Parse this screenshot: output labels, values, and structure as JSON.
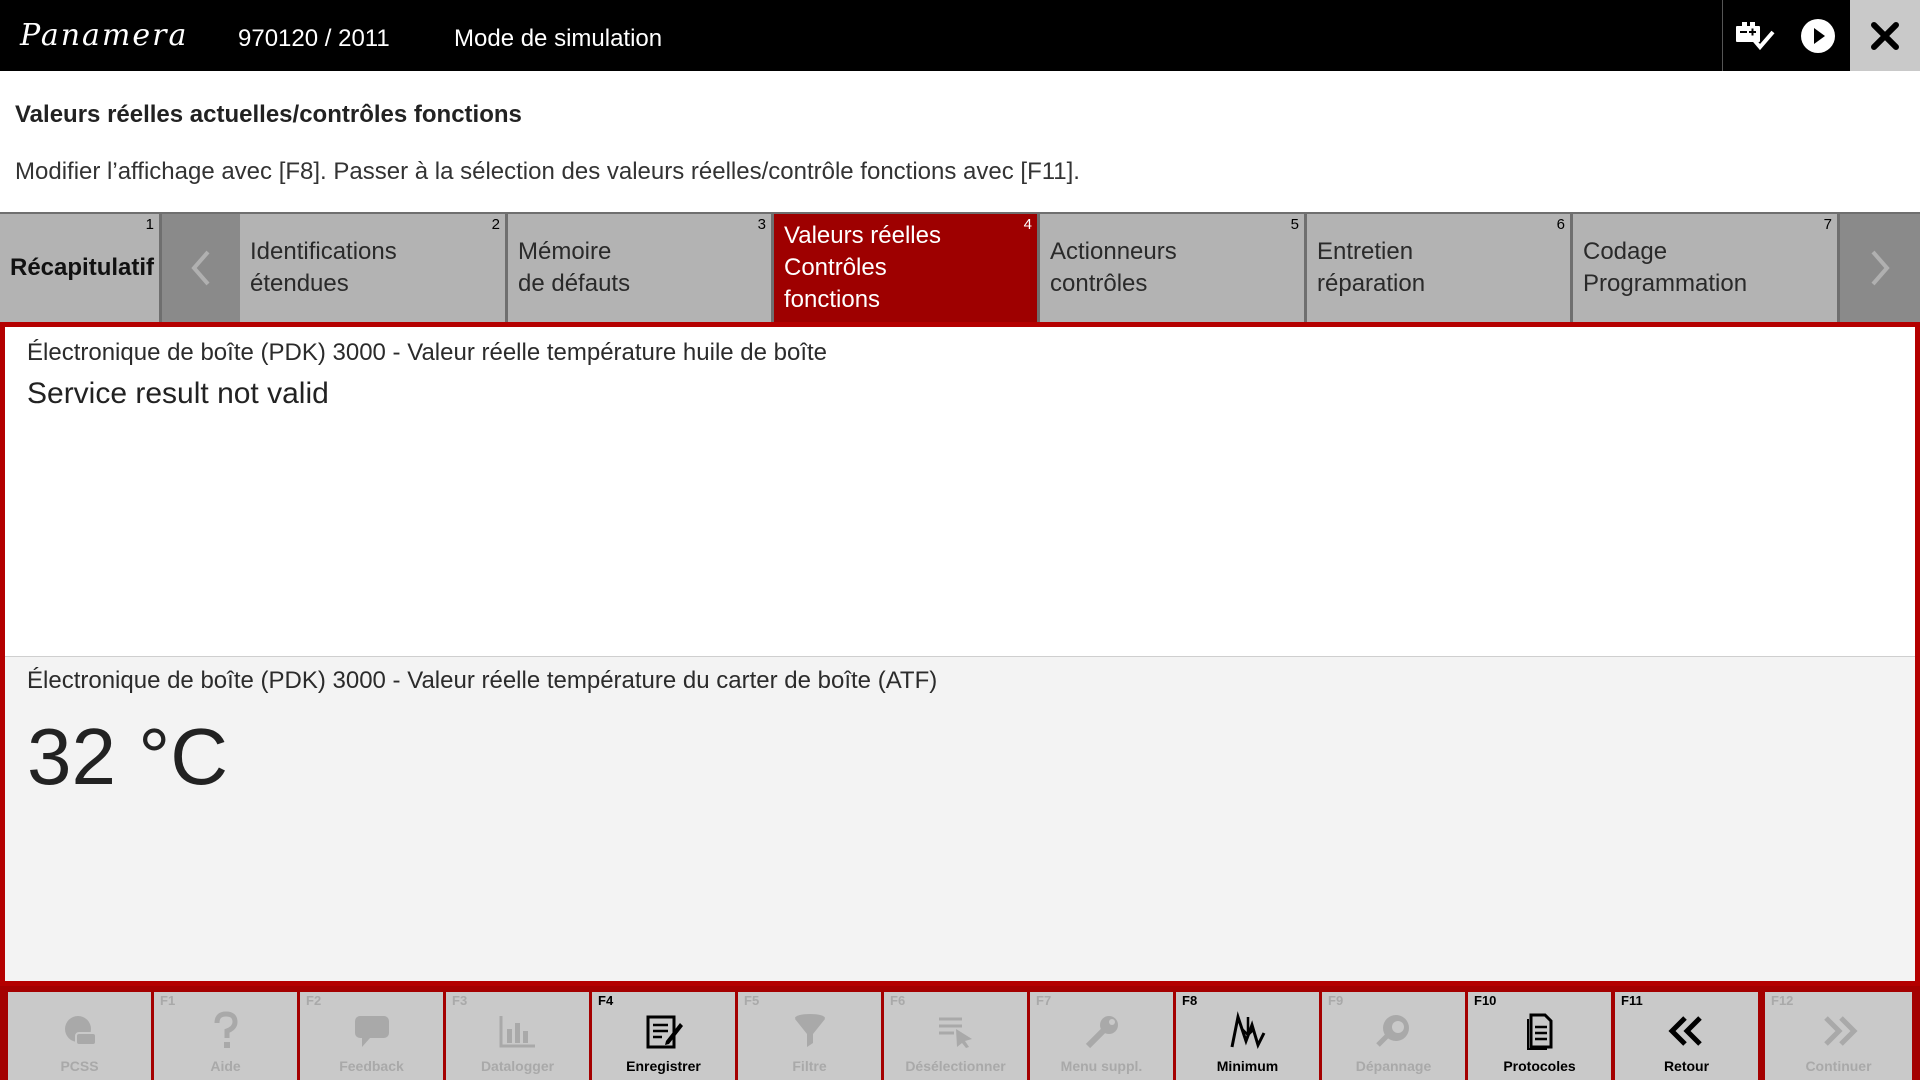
{
  "window": {
    "brand": "Panamera",
    "vehicle_id": "970120 / 2011",
    "mode": "Mode de simulation",
    "icons": [
      "vci-status-icon",
      "play-icon",
      "close-icon"
    ]
  },
  "header": {
    "title": "Valeurs réelles actuelles/contrôles fonctions",
    "hint": "Modifier l’affichage avec [F8]. Passer à la sélection des valeurs réelles/contrôle fonctions avec [F11]."
  },
  "tabs": [
    {
      "num": "1",
      "lines": [
        "Récapitulatif"
      ],
      "active": false
    },
    {
      "num": "2",
      "lines": [
        "Identifications",
        "étendues"
      ],
      "active": false
    },
    {
      "num": "3",
      "lines": [
        "Mémoire",
        "de défauts"
      ],
      "active": false
    },
    {
      "num": "4",
      "lines": [
        "Valeurs réelles",
        "Contrôles",
        "fonctions"
      ],
      "active": true
    },
    {
      "num": "5",
      "lines": [
        "Actionneurs",
        "contrôles"
      ],
      "active": false
    },
    {
      "num": "6",
      "lines": [
        "Entretien",
        "réparation"
      ],
      "active": false
    },
    {
      "num": "7",
      "lines": [
        "Codage",
        "Programmation"
      ],
      "active": false
    }
  ],
  "panels": [
    {
      "label": "Électronique de boîte (PDK) 3000 - Valeur réelle température huile de boîte",
      "value": "Service result not valid"
    },
    {
      "label": "Électronique de boîte (PDK) 3000 - Valeur réelle température du carter de boîte (ATF)",
      "value": "32 °C"
    }
  ],
  "fkeys": [
    {
      "key": "",
      "label": "PCSS",
      "icon": "pcss-icon",
      "enabled": false
    },
    {
      "key": "F1",
      "label": "Aide",
      "icon": "help-icon",
      "enabled": false
    },
    {
      "key": "F2",
      "label": "Feedback",
      "icon": "feedback-icon",
      "enabled": false
    },
    {
      "key": "F3",
      "label": "Datalogger",
      "icon": "datalogger-icon",
      "enabled": false
    },
    {
      "key": "F4",
      "label": "Enregistrer",
      "icon": "save-icon",
      "enabled": true
    },
    {
      "key": "F5",
      "label": "Filtre",
      "icon": "filter-icon",
      "enabled": false
    },
    {
      "key": "F6",
      "label": "Désélectionner",
      "icon": "deselect-icon",
      "enabled": false
    },
    {
      "key": "F7",
      "label": "Menu suppl.",
      "icon": "extra-menu-icon",
      "enabled": false
    },
    {
      "key": "F8",
      "label": "Minimum",
      "icon": "minimum-icon",
      "enabled": true
    },
    {
      "key": "F9",
      "label": "Dépannage",
      "icon": "troubleshooting-icon",
      "enabled": false
    },
    {
      "key": "F10",
      "label": "Protocoles",
      "icon": "protocols-icon",
      "enabled": true
    },
    {
      "key": "F11",
      "label": "Retour",
      "icon": "back-icon",
      "enabled": true
    },
    {
      "key": "F12",
      "label": "Continuer",
      "icon": "continue-icon",
      "enabled": false
    }
  ],
  "colors": {
    "accent": "#9e0000",
    "tab_bg": "#b3b3b3",
    "titlebar": "#000000"
  }
}
